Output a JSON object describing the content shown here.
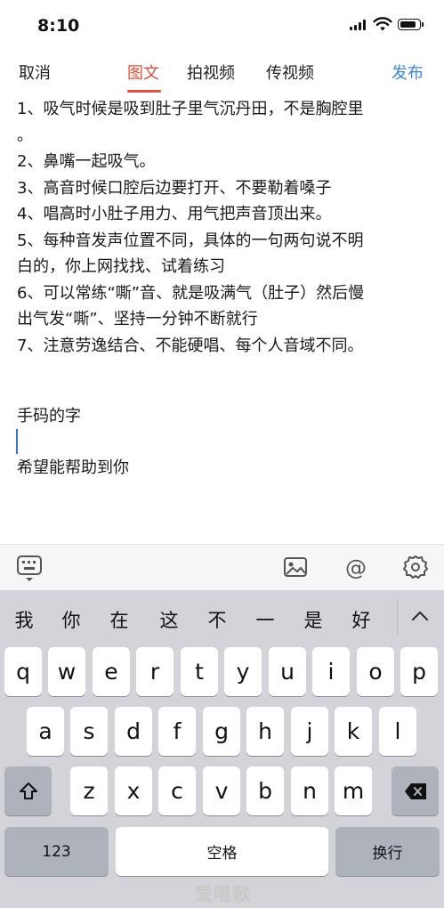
{
  "status_bar": {
    "time": "8:10"
  },
  "nav": {
    "cancel": "取消",
    "tabs": [
      "图文",
      "拍视频",
      "传视频"
    ],
    "publish": "发布"
  },
  "content": {
    "lines": [
      "1、吸气时候是吸到肚子里气沉丹田，不是胸腔里",
      "。",
      "2、鼻嘴一起吸气。",
      "3、高音时候口腔后边要打开、不要勒着嗓子",
      "4、唱高时小肚子用力、用气把声音顶出来。",
      "5、每种音发声位置不同，具体的一句两句说不明",
      "白的，你上网找找、试着练习",
      "6、可以常练“嘶”音、就是吸满气（肚子）然后慢",
      "出气发“嘶”、坚持一分钟不断就行",
      "7、注意劳逸结合、不能硬唱、每个人音域不同。"
    ],
    "signature": "手码的字",
    "closing": "希望能帮助到你"
  },
  "toolbar": {
    "icons": [
      "keyboard-icon",
      "image-icon",
      "at-icon",
      "settings-icon"
    ],
    "at_symbol": "@"
  },
  "keyboard": {
    "candidates": [
      "我",
      "你",
      "在",
      "这",
      "不",
      "一",
      "是",
      "好"
    ],
    "row1": [
      "q",
      "w",
      "e",
      "r",
      "t",
      "y",
      "u",
      "i",
      "o",
      "p"
    ],
    "row2": [
      "a",
      "s",
      "d",
      "f",
      "g",
      "h",
      "j",
      "k",
      "l"
    ],
    "row3": [
      "z",
      "x",
      "c",
      "v",
      "b",
      "n",
      "m"
    ],
    "numbers_key": "123",
    "space_key": "空格",
    "return_key": "换行"
  },
  "watermark": "爱唱歌",
  "colors": {
    "accent_red": "#e0523d",
    "publish_blue": "#3a86d9",
    "keyboard_bg": "#d2d4da"
  }
}
